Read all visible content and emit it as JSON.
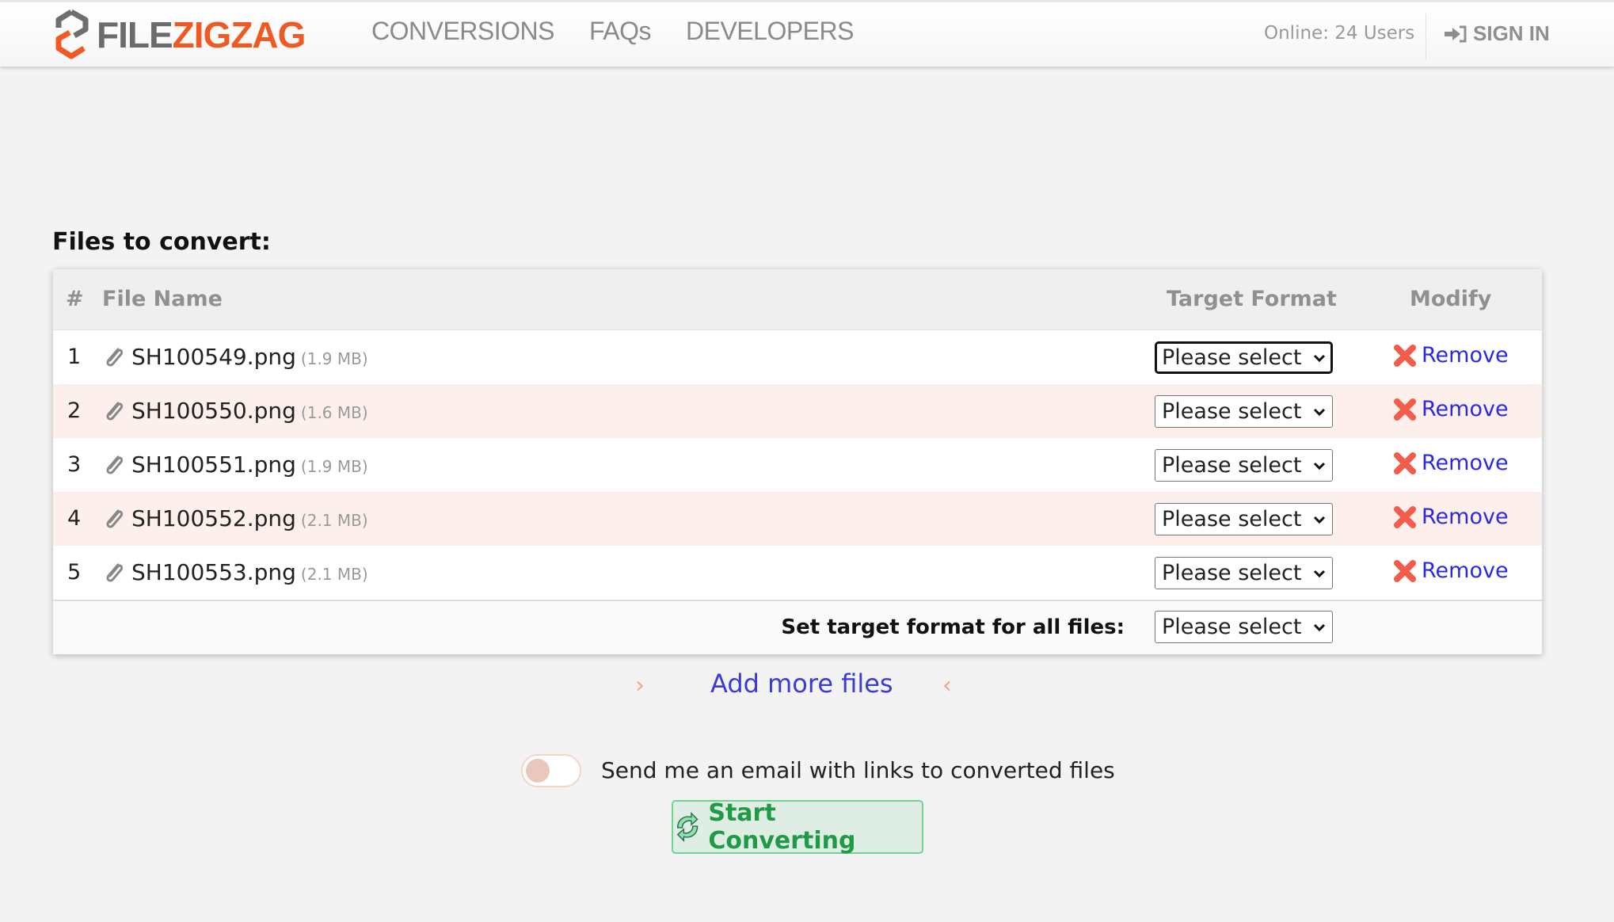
{
  "header": {
    "logo": {
      "part1": "FILE",
      "part2": "ZIGZAG",
      "icon": "zigzag-logo-icon"
    },
    "nav": [
      {
        "label": "CONVERSIONS"
      },
      {
        "label": "FAQs"
      },
      {
        "label": "DEVELOPERS"
      }
    ],
    "online_status": "Online: 24 Users",
    "sign_in": {
      "label": "SIGN IN",
      "icon": "sign-in-icon"
    }
  },
  "main": {
    "section_title": "Files to convert:",
    "table": {
      "columns": [
        "#",
        "File Name",
        "Target Format",
        "Modify"
      ],
      "rows": [
        {
          "num": "1",
          "file_name": "SH100549.png",
          "size": "(1.9 MB)",
          "target_format": "Please select",
          "modify_label": "Remove"
        },
        {
          "num": "2",
          "file_name": "SH100550.png",
          "size": "(1.6 MB)",
          "target_format": "Please select",
          "modify_label": "Remove"
        },
        {
          "num": "3",
          "file_name": "SH100551.png",
          "size": "(1.9 MB)",
          "target_format": "Please select",
          "modify_label": "Remove"
        },
        {
          "num": "4",
          "file_name": "SH100552.png",
          "size": "(2.1 MB)",
          "target_format": "Please select",
          "modify_label": "Remove"
        },
        {
          "num": "5",
          "file_name": "SH100553.png",
          "size": "(2.1 MB)",
          "target_format": "Please select",
          "modify_label": "Remove"
        }
      ],
      "footer": {
        "label": "Set target format for all files:",
        "target_format": "Please select"
      }
    },
    "add_more": {
      "label": "Add more files",
      "left_chevron": "›",
      "right_chevron": "‹"
    },
    "email_toggle": {
      "label": "Send me an email with links to converted files",
      "checked": false
    },
    "start_button": {
      "label": "Start Converting",
      "icon": "convert-arrows-icon"
    }
  },
  "colors": {
    "brand_orange": "#ef5a24",
    "link_blue": "#3a3ad8",
    "remove_red": "#f25c4a",
    "start_green": "#1f9a45",
    "row_alt": "#fdf0ec"
  }
}
